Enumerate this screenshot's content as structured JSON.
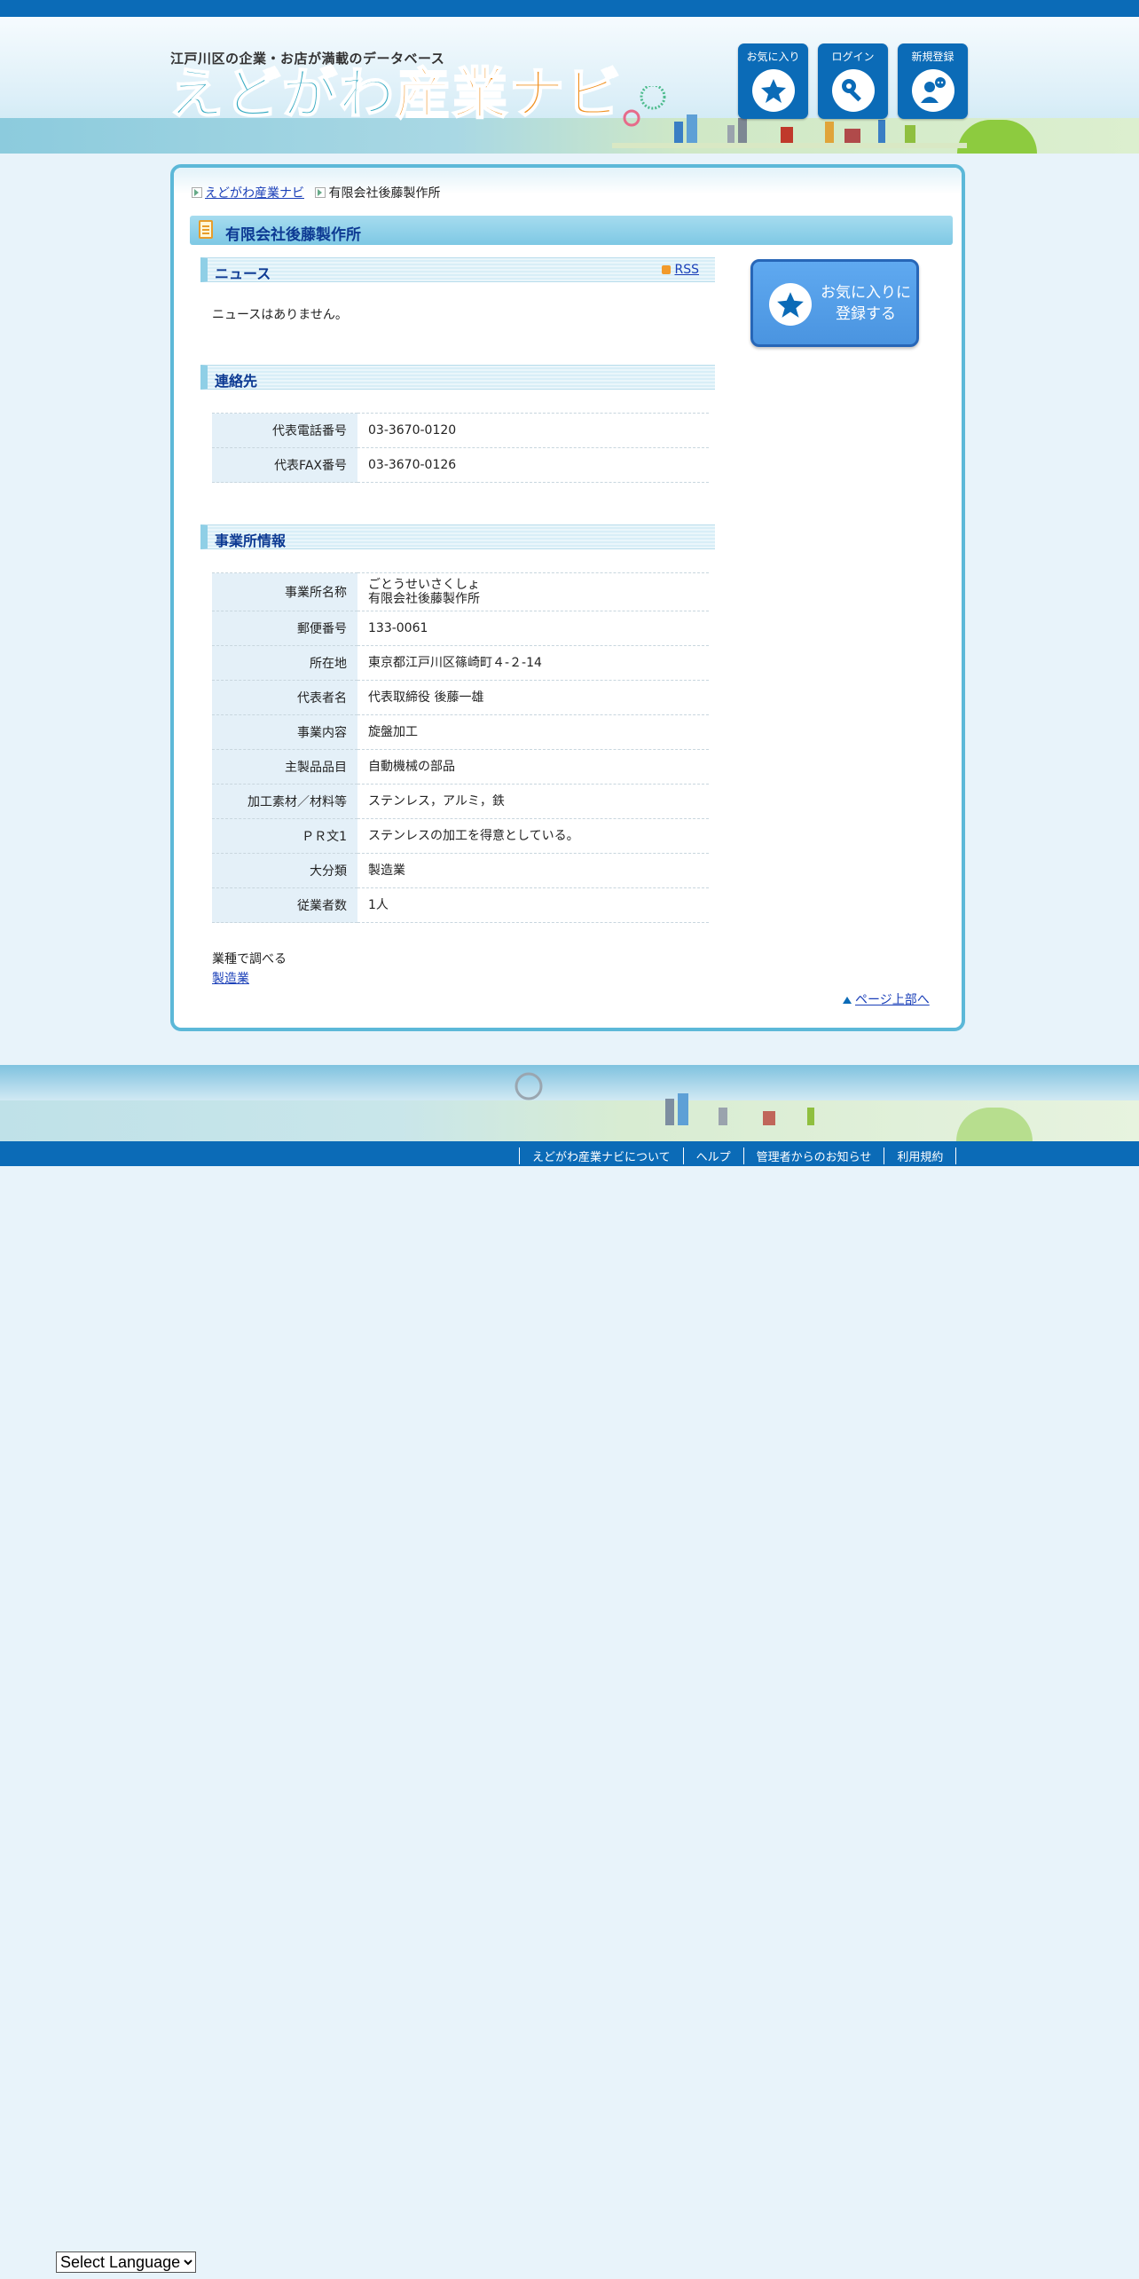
{
  "header": {
    "tagline": "江戸川区の企業・お店が満載のデータベース",
    "logo_part1": "えどがわ",
    "logo_part2": "産業ナビ",
    "buttons": [
      {
        "label": "お気に入り",
        "icon": "star-icon"
      },
      {
        "label": "ログイン",
        "icon": "key-icon"
      },
      {
        "label": "新規登録",
        "icon": "user-add-icon"
      }
    ]
  },
  "breadcrumb": {
    "home": "えどがわ産業ナビ",
    "current": "有限会社後藤製作所"
  },
  "page_title": "有限会社後藤製作所",
  "news": {
    "heading": "ニュース",
    "rss_label": "RSS",
    "empty_text": "ニュースはありません。"
  },
  "contact": {
    "heading": "連絡先",
    "rows": [
      {
        "label": "代表電話番号",
        "value": "03-3670-0120"
      },
      {
        "label": "代表FAX番号",
        "value": "03-3670-0126"
      }
    ]
  },
  "office": {
    "heading": "事業所情報",
    "name_label": "事業所名称",
    "name_kana": "ごとうせいさくしょ",
    "name": "有限会社後藤製作所",
    "rows": [
      {
        "label": "郵便番号",
        "value": "133-0061"
      },
      {
        "label": "所在地",
        "value": "東京都江戸川区篠崎町４-２-14"
      },
      {
        "label": "代表者名",
        "value": "代表取締役 後藤一雄"
      },
      {
        "label": "事業内容",
        "value": "旋盤加工"
      },
      {
        "label": "主製品品目",
        "value": "自動機械の部品"
      },
      {
        "label": "加工素材／材料等",
        "value": "ステンレス，アルミ，鉄"
      },
      {
        "label": "ＰＲ文1",
        "value": "ステンレスの加工を得意としている。"
      },
      {
        "label": "大分類",
        "value": "製造業"
      },
      {
        "label": "従業者数",
        "value": "1人"
      }
    ]
  },
  "by_type": {
    "label": "業種で調べる",
    "link": "製造業"
  },
  "page_top": "ページ上部へ",
  "favorite_button": {
    "line1": "お気に入りに",
    "line2": "登録する"
  },
  "footer": {
    "links": [
      "えどがわ産業ナビについて",
      "ヘルプ",
      "管理者からのお知らせ",
      "利用規約"
    ]
  },
  "language_select": {
    "selected": "Select Language"
  },
  "colors": {
    "brand_blue": "#0b6bb7",
    "panel_border": "#5cb8d8",
    "title_text": "#0d3a93",
    "logo_teal": "#33a9c1",
    "logo_orange": "#f0901f"
  }
}
